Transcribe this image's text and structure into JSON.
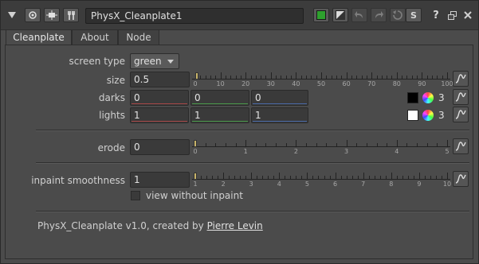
{
  "node_name": "PhysX_Cleanplate1",
  "tabs": [
    "Cleanplate",
    "About",
    "Node"
  ],
  "help_label": "?",
  "s_label": "S",
  "screen_type": {
    "label": "screen type",
    "value": "green"
  },
  "size": {
    "label": "size",
    "value": "0.5",
    "ticks": [
      "0",
      "10",
      "20",
      "30",
      "40",
      "50",
      "60",
      "70",
      "80",
      "90",
      "100"
    ],
    "slider_value": 0.5,
    "slider_max": 100
  },
  "darks": {
    "label": "darks",
    "values": [
      "0",
      "0",
      "0"
    ],
    "count": "3"
  },
  "lights": {
    "label": "lights",
    "values": [
      "1",
      "1",
      "1"
    ],
    "count": "3"
  },
  "erode": {
    "label": "erode",
    "value": "0",
    "ticks": [
      "0",
      "1",
      "2",
      "3",
      "4",
      "5"
    ],
    "slider_value": 0,
    "slider_max": 5
  },
  "inpaint": {
    "label": "inpaint smoothness",
    "value": "1",
    "ticks": [
      "1",
      "2",
      "3",
      "4",
      "5",
      "6",
      "7",
      "8",
      "9",
      "10"
    ],
    "slider_value": 1,
    "slider_max": 10,
    "slider_min": 1
  },
  "view_without_inpaint": {
    "label": "view without inpaint",
    "checked": false
  },
  "credit": {
    "text": "PhysX_Cleanplate v1.0, created by ",
    "author": "Pierre Levin"
  },
  "colors": {
    "red_line": "#a84848",
    "green_line": "#4a9a4a",
    "blue_line": "#4a6aa8",
    "node_color_button": "#2ea02e",
    "slider_handle": "#c8b46a"
  }
}
